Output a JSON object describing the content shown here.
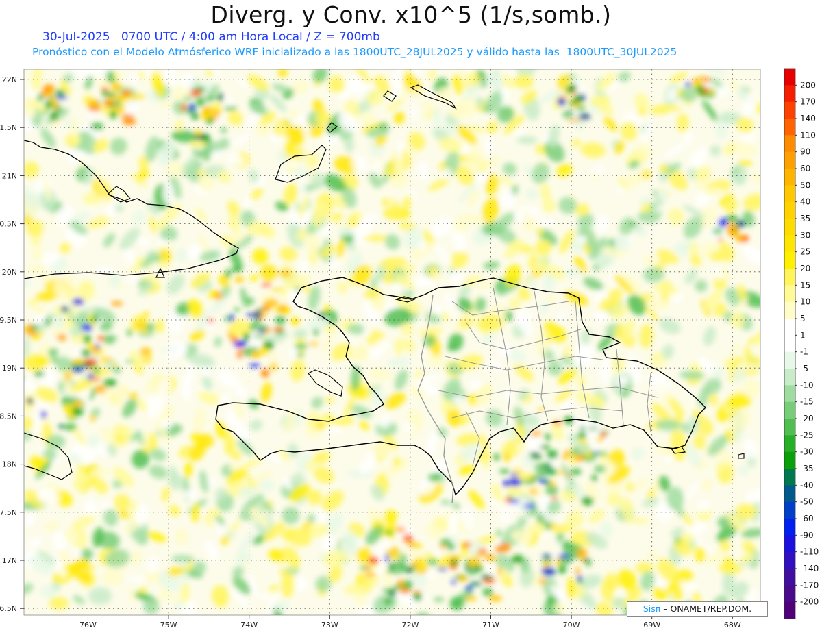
{
  "header": {
    "title": "Diverg. y Conv. x10^5 (1/s,somb.)",
    "subtitle_time": "30-Jul-2025   0700 UTC / 4:00 am Hora Local / Z = 700mb",
    "subtitle_model": "Pronóstico con el Modelo Atmósferico WRF inicializado a las 1800UTC_28JUL2025 y válido hasta las  1800UTC_30JUL2025"
  },
  "map": {
    "lat_labels": [
      "22N",
      "1.5N",
      "21N",
      "0.5N",
      "20N",
      "9.5N",
      "19N",
      "8.5N",
      "18N",
      "7.5N",
      "17N",
      "6.5N"
    ],
    "lon_labels": [
      "76W",
      "75W",
      "74W",
      "73W",
      "72W",
      "71W",
      "70W",
      "69W",
      "68W"
    ],
    "lat_range": [
      16.5,
      22.0
    ],
    "lon_range": [
      -76.6,
      -67.6
    ],
    "grid": "dotted"
  },
  "colorbar": {
    "labels": [
      "200",
      "170",
      "140",
      "110",
      "90",
      "60",
      "50",
      "40",
      "35",
      "30",
      "25",
      "20",
      "15",
      "10",
      "5",
      "1",
      "-1",
      "-5",
      "-10",
      "-15",
      "-20",
      "-25",
      "-30",
      "-35",
      "-40",
      "-50",
      "-60",
      "-90",
      "-110",
      "-140",
      "-170",
      "-200"
    ],
    "colors": [
      "#e60000",
      "#f51e00",
      "#ff4100",
      "#ff6400",
      "#ff8c00",
      "#ffa000",
      "#ffb400",
      "#ffc800",
      "#ffd200",
      "#ffdc00",
      "#ffe600",
      "#fff000",
      "#fff55a",
      "#fffa96",
      "#fffcc8",
      "#ffffff",
      "#ffffff",
      "#e8f8e8",
      "#c8ebc8",
      "#a0dca0",
      "#78cd78",
      "#50be50",
      "#28af28",
      "#0aa00a",
      "#007850",
      "#005a8c",
      "#0040c8",
      "#0020f0",
      "#1a10e0",
      "#3010c0",
      "#400fa0",
      "#4a0a8c",
      "#500078"
    ]
  },
  "credit": {
    "brand": "Sisπ",
    "text": " – ONAMET/REP.DOM."
  }
}
